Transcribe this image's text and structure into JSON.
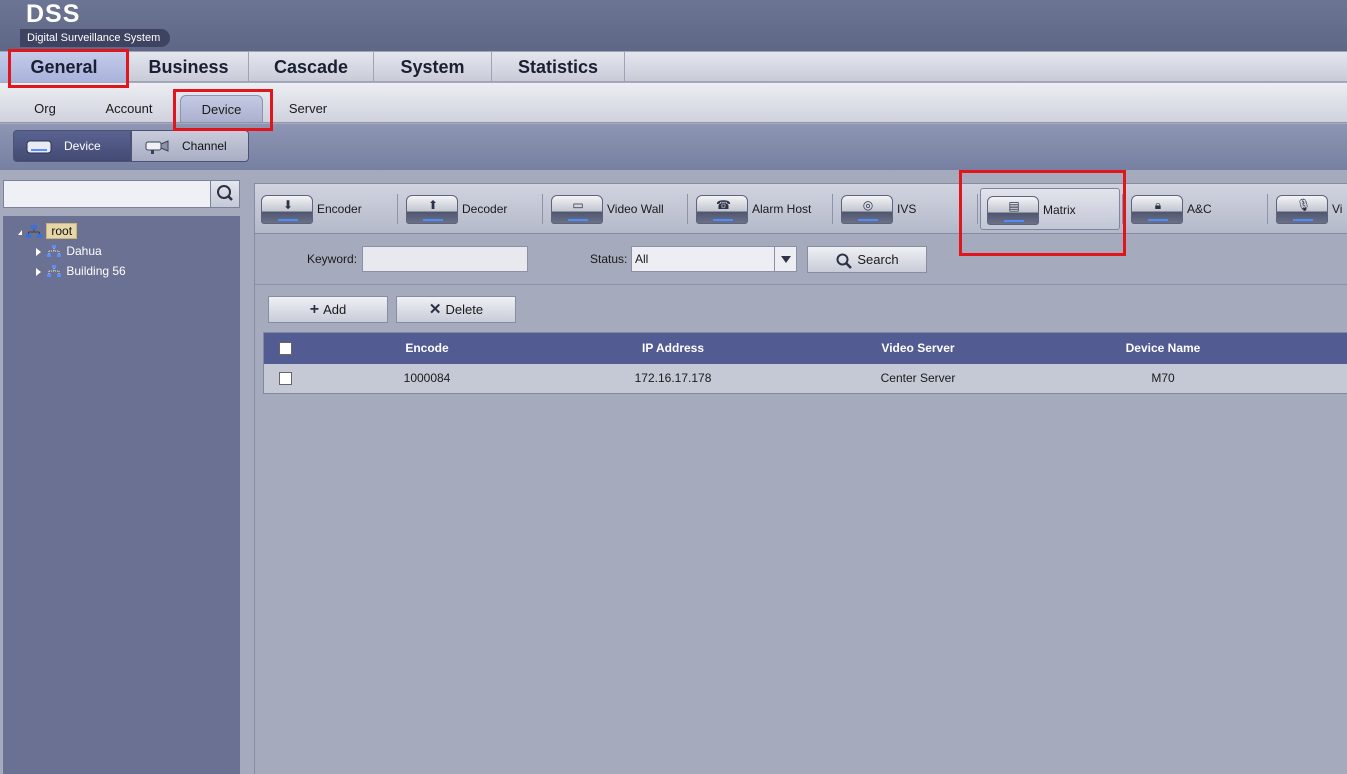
{
  "app": {
    "logo": "DSS",
    "subtitle": "Digital Surveillance System"
  },
  "main_nav": {
    "tabs": [
      "General",
      "Business",
      "Cascade",
      "System",
      "Statistics"
    ],
    "active": "General"
  },
  "sub_nav": {
    "tabs": [
      "Org",
      "Account",
      "Device",
      "Server"
    ],
    "active": "Device"
  },
  "mode_bar": {
    "device": "Device",
    "channel": "Channel",
    "active": "Device"
  },
  "tree": {
    "root": "root",
    "children": [
      "Dahua",
      "Building 56"
    ]
  },
  "device_types": {
    "items": [
      "Encoder",
      "Decoder",
      "Video Wall",
      "Alarm Host",
      "IVS",
      "Matrix",
      "A&C",
      "Vi"
    ],
    "active": "Matrix"
  },
  "filter": {
    "keyword_label": "Keyword:",
    "keyword_value": "",
    "status_label": "Status:",
    "status_value": "All",
    "search_label": "Search"
  },
  "actions": {
    "add": "Add",
    "delete": "Delete"
  },
  "table": {
    "columns": [
      "Encode",
      "IP Address",
      "Video Server",
      "Device Name"
    ],
    "rows": [
      {
        "encode": "1000084",
        "ip": "172.16.17.178",
        "server": "Center Server",
        "name": "M70"
      }
    ]
  },
  "colors": {
    "highlight": "#e0161c",
    "table_header": "#525b92",
    "accent_led": "#4f8cff"
  },
  "highlights": [
    "General",
    "Device",
    "Matrix"
  ]
}
